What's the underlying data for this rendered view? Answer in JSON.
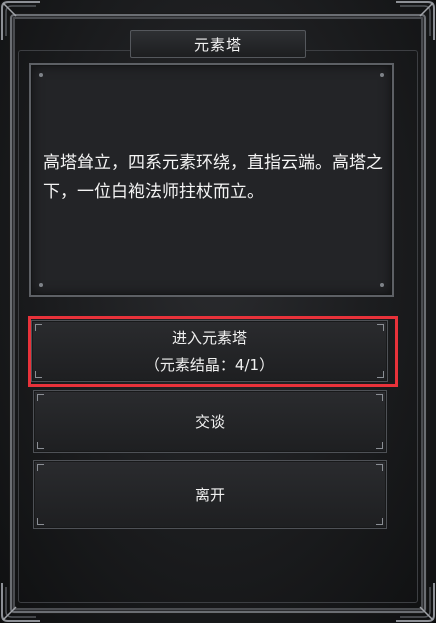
{
  "dialog": {
    "title": "元素塔",
    "description": "高塔耸立，四系元素环绕，直指云端。高塔之下，一位白袍法师拄杖而立。"
  },
  "options": [
    {
      "label": "进入元素塔",
      "sublabel": "（元素结晶：4/1）"
    },
    {
      "label": "交谈"
    },
    {
      "label": "离开"
    }
  ],
  "highlight_color": "#e8323a"
}
